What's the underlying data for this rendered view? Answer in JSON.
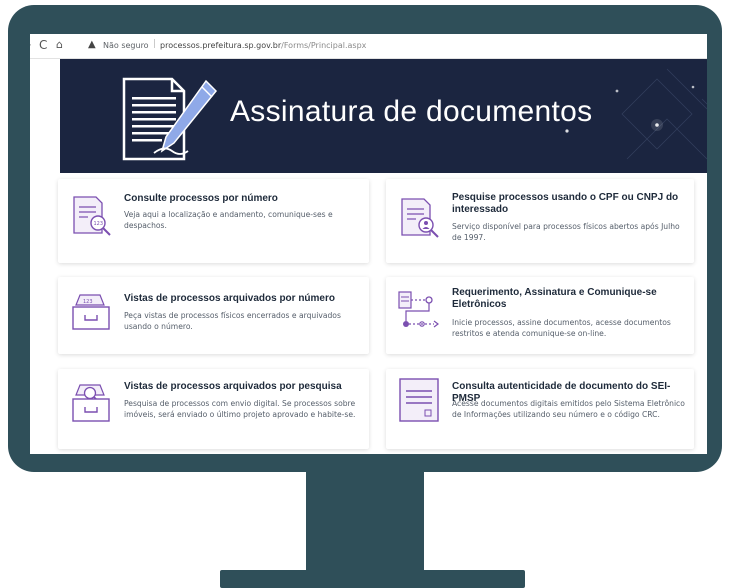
{
  "browser": {
    "back_icon": "back-arrow-icon",
    "reload_icon": "reload-icon",
    "home_icon": "home-icon",
    "security_icon": "warning-icon",
    "security_label": "Não seguro",
    "separator": "|",
    "url_domain": "processos.prefeitura.sp.gov.br",
    "url_path": "/Forms/Principal.aspx"
  },
  "banner": {
    "title": "Assinatura de documentos",
    "icon": "document-signing-icon",
    "background": "#1b2540"
  },
  "cards": [
    {
      "title": "Consulte processos por número",
      "description": "Veja aqui a localização e andamento, comunique-ses e despachos.",
      "icon": "document-search-number-icon"
    },
    {
      "title": "Pesquise processos usando o CPF ou CNPJ do interessado",
      "description": "Serviço disponível para processos físicos abertos após Julho de 1997.",
      "icon": "document-search-person-icon"
    },
    {
      "title": "Vistas de processos arquivados por número",
      "description": "Peça vistas de processos físicos encerrados e arquivados usando o número.",
      "icon": "archive-box-icon"
    },
    {
      "title": "Requerimento, Assinatura e Comunique-se Eletrônicos",
      "description": "Inicie processos, assine documentos, acesse documentos restritos e atenda comunique-se on-line.",
      "icon": "workflow-icon"
    },
    {
      "title": "Vistas de processos arquivados por pesquisa",
      "description": "Pesquisa de processos com envio digital. Se processos sobre imóveis, será enviado o último projeto aprovado e habite-se.",
      "icon": "archive-search-icon"
    },
    {
      "title": "Consulta autenticidade de documento do SEI-PMSP",
      "description": "Acesse documentos digitais emitidos pelo Sistema Eletrônico de Informações utilizando seu número e o código CRC.",
      "icon": "certificate-document-icon"
    }
  ],
  "colors": {
    "monitor_frame": "#2f4f59",
    "icon_accent": "#7b4fb0",
    "title_text": "#1e2a3a"
  }
}
